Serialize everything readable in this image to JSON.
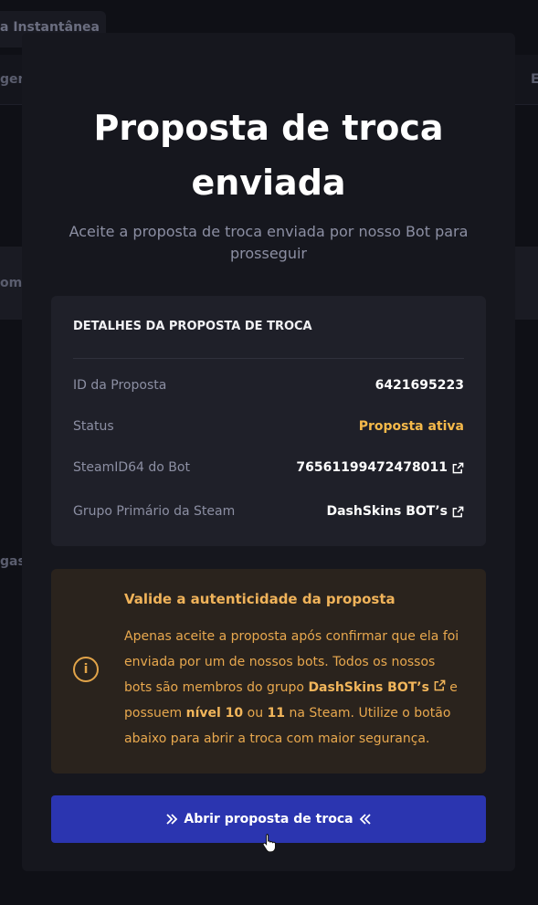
{
  "background": {
    "tab_label": "a Instantânea",
    "nav_left": "gen",
    "nav_right": "E",
    "promo_text": "oma",
    "side_text": "gas"
  },
  "modal": {
    "title_line1": "Proposta de troca",
    "title_line2": "enviada",
    "subtitle": "Aceite a proposta de troca enviada por nosso Bot para prosseguir",
    "details": {
      "title": "DETALHES DA PROPOSTA DE TROCA",
      "rows": [
        {
          "label": "ID da Proposta",
          "value": "6421695223"
        },
        {
          "label": "Status",
          "value": "Proposta ativa"
        },
        {
          "label": "SteamID64 do Bot",
          "value": "76561199472478011"
        },
        {
          "label": "Grupo Primário da Steam",
          "value": "DashSkins BOT’s"
        }
      ]
    },
    "warning": {
      "icon": "info-icon",
      "icon_glyph": "i",
      "title": "Valide a autenticidade da proposta",
      "text_1": "Apenas aceite a proposta após confirmar que ela foi enviada por um de nossos bots. Todos os nossos bots são membros do grupo ",
      "group_link": "DashSkins BOT’s",
      "text_2": " e possuem ",
      "level_a": "nível 10",
      "text_3": " ou ",
      "level_b": "11",
      "text_4": " na Steam. Utilize o botão abaixo para abrir a troca com maior segurança."
    },
    "cta_label": "Abrir proposta de troca"
  },
  "colors": {
    "accent_button": "#2b35b0",
    "status_active": "#f5b94a",
    "warning_text": "#e8a84e",
    "warning_bg": "#2a231d"
  }
}
